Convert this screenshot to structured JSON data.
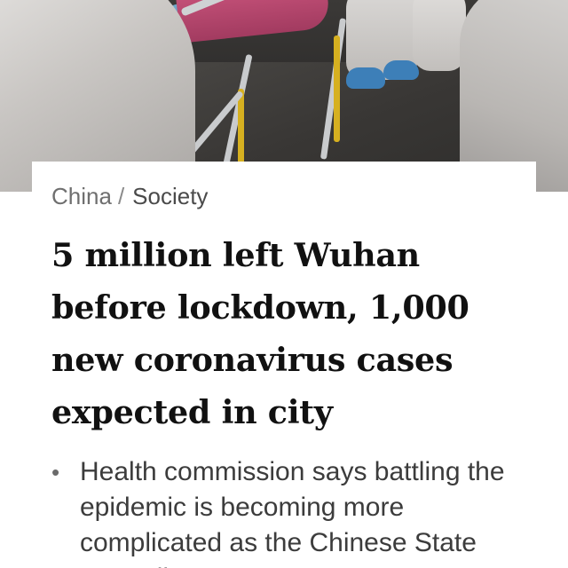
{
  "breadcrumb": {
    "primary": "China",
    "separator": "/",
    "secondary": "Society"
  },
  "article": {
    "headline": "5 million left Wuhan before lockdown, 1,000 new coronavirus cases expected in city",
    "summary_bullet": "•",
    "summary": "Health commission says battling the epidemic is becoming more complicated as the Chinese State Council"
  },
  "hero_image": {
    "icon": "news-photo-icon"
  },
  "colors": {
    "headline": "#111111",
    "breadcrumb": "#5a5a5a",
    "summary_text": "#3c3c3c",
    "background": "#ffffff"
  }
}
